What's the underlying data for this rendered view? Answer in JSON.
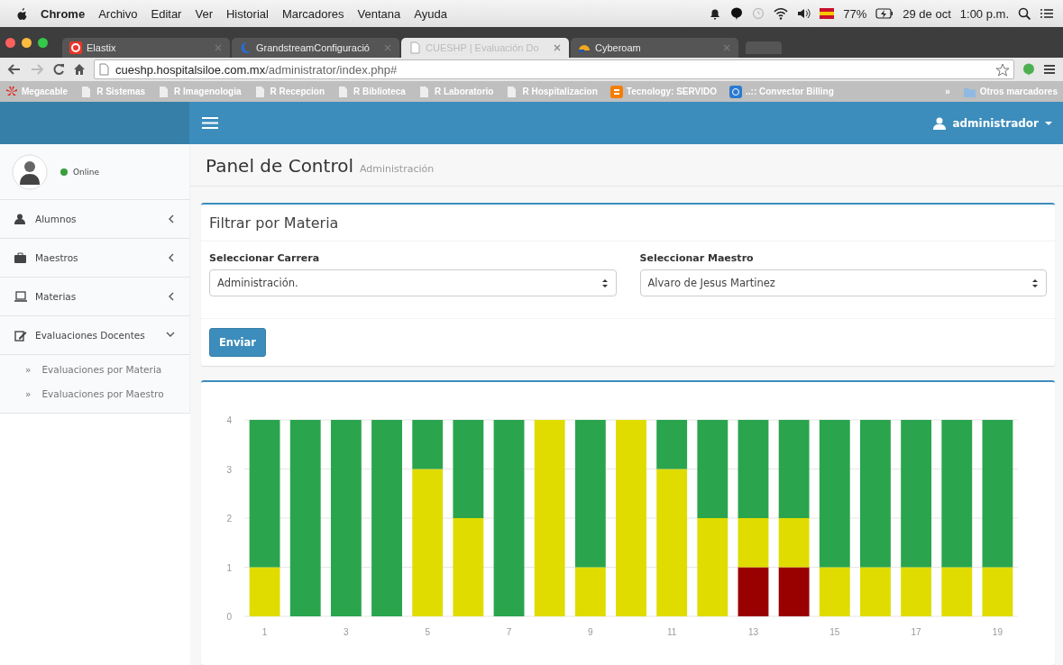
{
  "menu_bar": {
    "app": "Chrome",
    "items": [
      "Archivo",
      "Editar",
      "Ver",
      "Historial",
      "Marcadores",
      "Ventana",
      "Ayuda"
    ],
    "battery": "77%",
    "date": "29 de oct",
    "time": "1:00 p.m."
  },
  "browser": {
    "tabs": [
      {
        "title": "Elastix",
        "kind": "elastix",
        "selected": false
      },
      {
        "title": "GrandstreamConfiguració",
        "kind": "moon",
        "selected": false
      },
      {
        "title": "CUESHP | Evaluación Do",
        "kind": "page",
        "selected": true
      },
      {
        "title": "Cyberoam",
        "kind": "cyberoam",
        "selected": false
      }
    ],
    "address": {
      "host": "cueshp.hospitalsiloe.com.mx",
      "path": "/administrator/index.php#"
    },
    "bookmarks": [
      {
        "label": "Megacable",
        "kind": "huawei"
      },
      {
        "label": "R Sistemas",
        "kind": "page"
      },
      {
        "label": "R Imagenologia",
        "kind": "page"
      },
      {
        "label": "R Recepcion",
        "kind": "page"
      },
      {
        "label": "R Biblioteca",
        "kind": "page"
      },
      {
        "label": "R Laboratorio",
        "kind": "page"
      },
      {
        "label": "R Hospitalizacion",
        "kind": "page"
      },
      {
        "label": "Tecnology: SERVIDO",
        "kind": "blogger"
      },
      {
        "label": "..:: Convector Billing",
        "kind": "app"
      }
    ],
    "more": "»",
    "other_bookmarks": "Otros marcadores"
  },
  "header": {
    "user": "administrador"
  },
  "sidebar": {
    "status": "Online",
    "items": [
      {
        "label": "Alumnos",
        "kind": "user",
        "expanded": false
      },
      {
        "label": "Maestros",
        "kind": "briefcase",
        "expanded": false
      },
      {
        "label": "Materias",
        "kind": "laptop",
        "expanded": false
      },
      {
        "label": "Evaluaciones Docentes",
        "kind": "edit",
        "expanded": true,
        "children": [
          {
            "label": "Evaluaciones por Materia",
            "marker": "»"
          },
          {
            "label": "Evaluaciones por Maestro",
            "marker": "»"
          }
        ]
      }
    ]
  },
  "page": {
    "title": "Panel de Control",
    "subtitle": "Administración"
  },
  "filter": {
    "title": "Filtrar por Materia",
    "fields": [
      {
        "label": "Seleccionar Carrera",
        "value": "Administración."
      },
      {
        "label": "Seleccionar Maestro",
        "value": "Alvaro de Jesus Martinez"
      }
    ],
    "button": "Enviar"
  },
  "chart_data": {
    "type": "bar",
    "stacked": true,
    "grid": true,
    "x": [
      1,
      2,
      3,
      4,
      5,
      6,
      7,
      8,
      9,
      10,
      11,
      12,
      13,
      14,
      15,
      16,
      17,
      18,
      19
    ],
    "series": [
      {
        "color": "#990000",
        "values": [
          0,
          0,
          0,
          0,
          0,
          0,
          0,
          0,
          0,
          0,
          0,
          0,
          1,
          1,
          0,
          0,
          0,
          0,
          0
        ]
      },
      {
        "color": "#e0dc00",
        "values": [
          1,
          0,
          0,
          0,
          3,
          2,
          0,
          4,
          1,
          4,
          3,
          2,
          1,
          1,
          1,
          1,
          1,
          1,
          1
        ]
      },
      {
        "color": "#2aa54d",
        "values": [
          3,
          4,
          4,
          4,
          1,
          2,
          4,
          0,
          3,
          0,
          1,
          2,
          2,
          2,
          3,
          3,
          3,
          3,
          3
        ]
      }
    ],
    "xlim": [
      0.5,
      19.5
    ],
    "ylim": [
      0,
      4
    ],
    "yticks": [
      0,
      1,
      2,
      3,
      4
    ],
    "xticks": [
      1,
      3,
      5,
      7,
      9,
      11,
      13,
      15,
      17,
      19
    ]
  }
}
